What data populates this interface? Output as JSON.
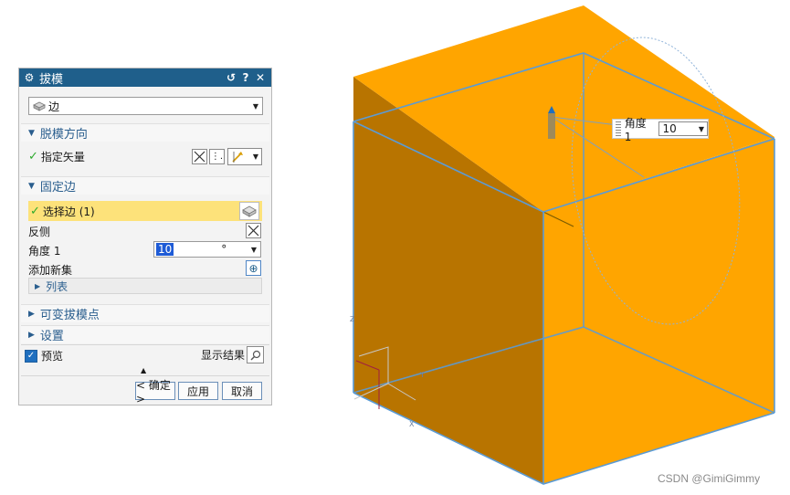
{
  "dialog": {
    "title": "拔模",
    "title_buttons": {
      "reset": "↺",
      "help": "?",
      "close": "✕"
    },
    "type_select": {
      "value": "边"
    },
    "sections": {
      "draw_direction": {
        "title": "脱模方向",
        "specify_vector_label": "指定矢量"
      },
      "fixed_edges": {
        "title": "固定边",
        "select_edge_label": "选择边 (1)",
        "reverse_label": "反侧",
        "angle_label": "角度 1",
        "angle_value": "10",
        "angle_unit": "°",
        "add_set_label": "添加新集",
        "list_label": "列表"
      },
      "variable_points": {
        "title": "可变拔模点"
      },
      "settings": {
        "title": "设置"
      }
    },
    "preview": {
      "label": "预览",
      "checked": true,
      "show_result_label": "显示结果"
    },
    "buttons": {
      "ok": "< 确定 >",
      "apply": "应用",
      "cancel": "取消"
    }
  },
  "viewport": {
    "angle_handle": {
      "label": "角度 1",
      "value": "10"
    },
    "axis_labels": {
      "x": "X",
      "y": "Y",
      "z": "Z"
    },
    "colors": {
      "part": "#ffa500",
      "part_dark": "#b87400",
      "edge": "#5b9bd5"
    }
  },
  "watermark": "CSDN @GimiGimmy"
}
